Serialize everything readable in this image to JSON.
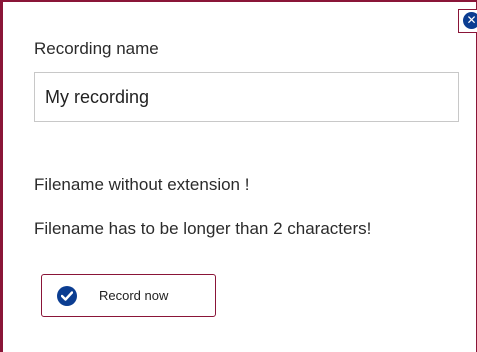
{
  "form": {
    "name_label": "Recording name",
    "name_value": "My recording",
    "messages": [
      "Filename without extension !",
      "Filename has to be longer than 2 characters!"
    ],
    "record_label": "Record now"
  },
  "icons": {
    "close": "close-icon",
    "record": "check-circle-icon"
  },
  "colors": {
    "border_accent": "#8a1538",
    "icon_blue": "#0b3d91"
  }
}
